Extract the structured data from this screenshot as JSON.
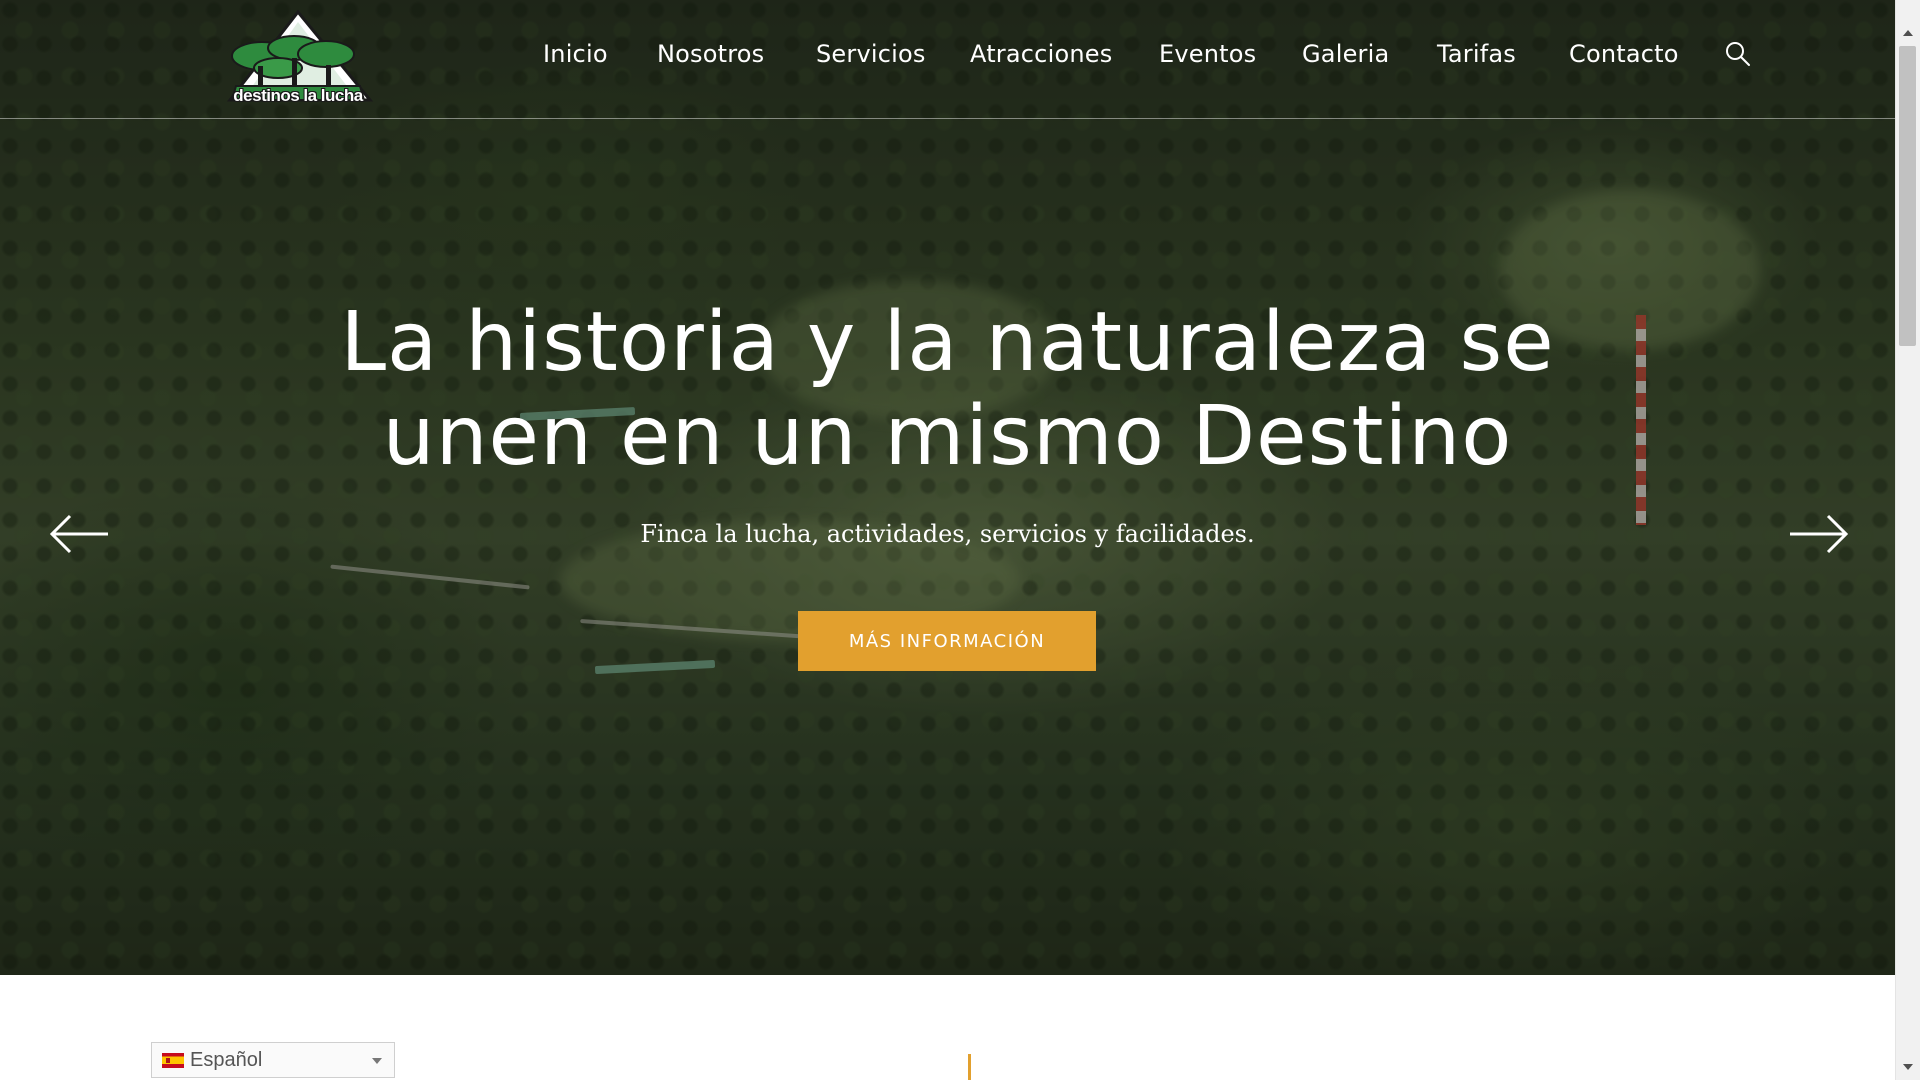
{
  "brand": {
    "logo_text": "destinos la lucha",
    "logo_icon": "mountain-trees-logo"
  },
  "nav": {
    "items": [
      {
        "label": "Inicio"
      },
      {
        "label": "Nosotros"
      },
      {
        "label": "Servicios"
      },
      {
        "label": "Atracciones"
      },
      {
        "label": "Eventos"
      },
      {
        "label": "Galeria"
      },
      {
        "label": "Tarifas"
      },
      {
        "label": "Contacto"
      }
    ],
    "search_icon": "search-icon"
  },
  "hero": {
    "title_line1": "La historia y la naturaleza se",
    "title_line2": "unen en un mismo Destino",
    "subtitle": "Finca la lucha, actividades, servicios y facilidades.",
    "cta_label": "MÁS INFORMACIÓN",
    "prev_icon": "arrow-left-icon",
    "next_icon": "arrow-right-icon"
  },
  "language": {
    "selected": "Español",
    "flag_icon": "spain-flag-icon"
  },
  "colors": {
    "accent": "#e2a02e",
    "text_on_hero": "#ffffff",
    "logo_green": "#2e8b3e"
  }
}
